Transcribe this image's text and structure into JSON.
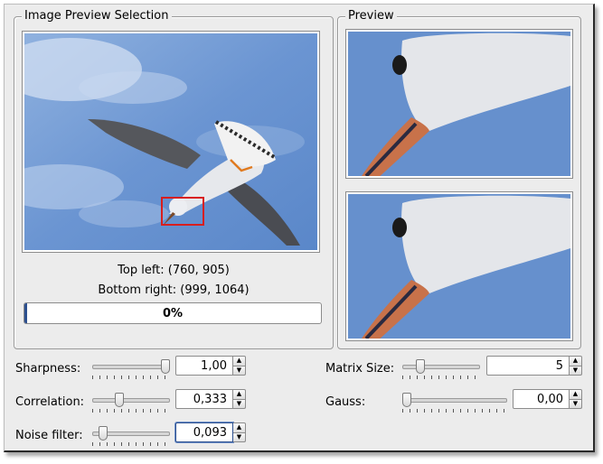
{
  "selection_group": {
    "title": "Image Preview Selection",
    "top_left_text": "Top left: (760, 905)",
    "bottom_right_text": "Bottom right: (999, 1064)",
    "progress_label": "0%",
    "progress_value": 0.01
  },
  "preview_group": {
    "title": "Preview"
  },
  "controls": {
    "sharpness": {
      "label": "Sharpness:",
      "value": "1,00",
      "level": 1.0
    },
    "correlation": {
      "label": "Correlation:",
      "value": "0,333",
      "level": 0.333
    },
    "noise_filter": {
      "label": "Noise filter:",
      "value": "0,093",
      "level": 0.093
    },
    "matrix_size": {
      "label": "Matrix Size:",
      "value": "5",
      "level": 0.2
    },
    "gauss": {
      "label": "Gauss:",
      "value": "0,00",
      "level": 0.0
    }
  },
  "icons": {
    "spin_up": "▲",
    "spin_down": "▼"
  },
  "colors": {
    "accent": "#2c4f8e",
    "selection_box": "#d81e1e",
    "sky": "#6c93cf"
  }
}
